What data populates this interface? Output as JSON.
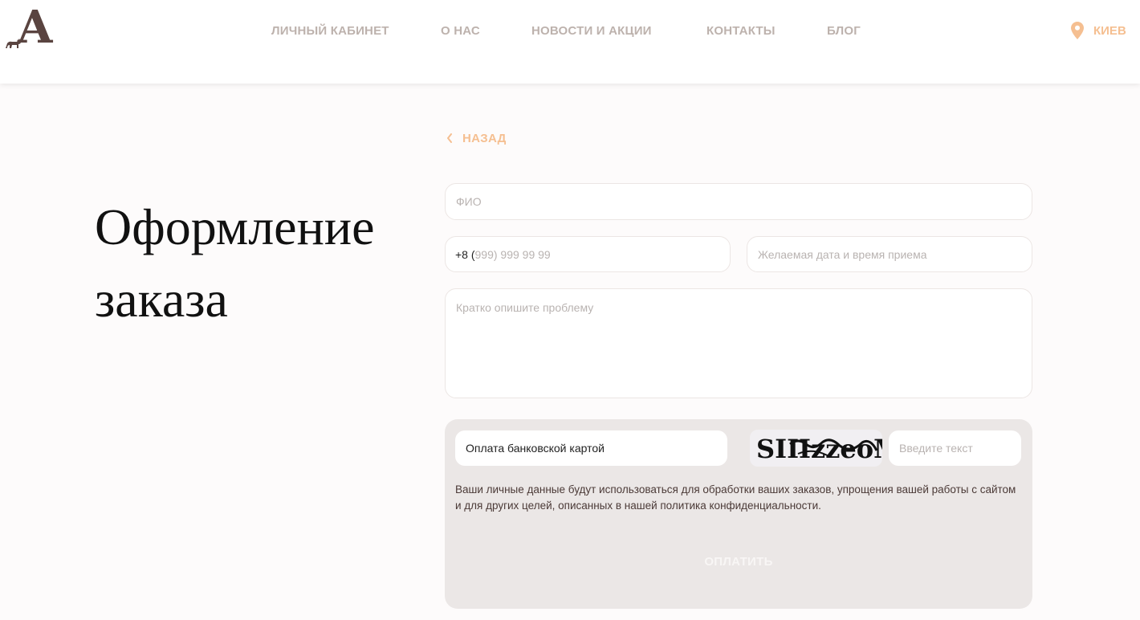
{
  "header": {
    "logo_letter": "A",
    "nav": [
      {
        "label": "ЛИЧНЫЙ КАБИНЕТ"
      },
      {
        "label": "О НАС"
      },
      {
        "label": "НОВОСТИ И АКЦИИ"
      },
      {
        "label": "КОНТАКТЫ"
      },
      {
        "label": "БЛОГ"
      }
    ],
    "city": {
      "icon": "location-pin-icon",
      "label": "КИЕВ"
    }
  },
  "page_title_line1": "Оформление",
  "page_title_line2": "заказа",
  "back": {
    "icon": "chevron-left-icon",
    "label": "НАЗАД"
  },
  "form": {
    "name_placeholder": "ФИО",
    "phone_prefix": "+8 (",
    "phone_rest": "999) 999 99 99",
    "datetime_placeholder": "Желаемая дата и время приема",
    "problem_placeholder": "Кратко опишите проблему"
  },
  "payment": {
    "method_label": "Оплата банковской картой",
    "captcha_placeholder": "Введите текст",
    "captcha_text": "SIIIzzeoM",
    "privacy_text": "Ваши личные данные будут использоваться для обработки ваших заказов, упрощения вашей работы с сайтом и для других целей, описанных в нашей политика конфиденциальности.",
    "pay_label": "ОПЛАТИТЬ"
  },
  "colors": {
    "accent": "#f5bf91",
    "nav_text": "#bdb2ad",
    "logo": "#5a4440",
    "pay_block_bg": "#ebe7e6"
  }
}
